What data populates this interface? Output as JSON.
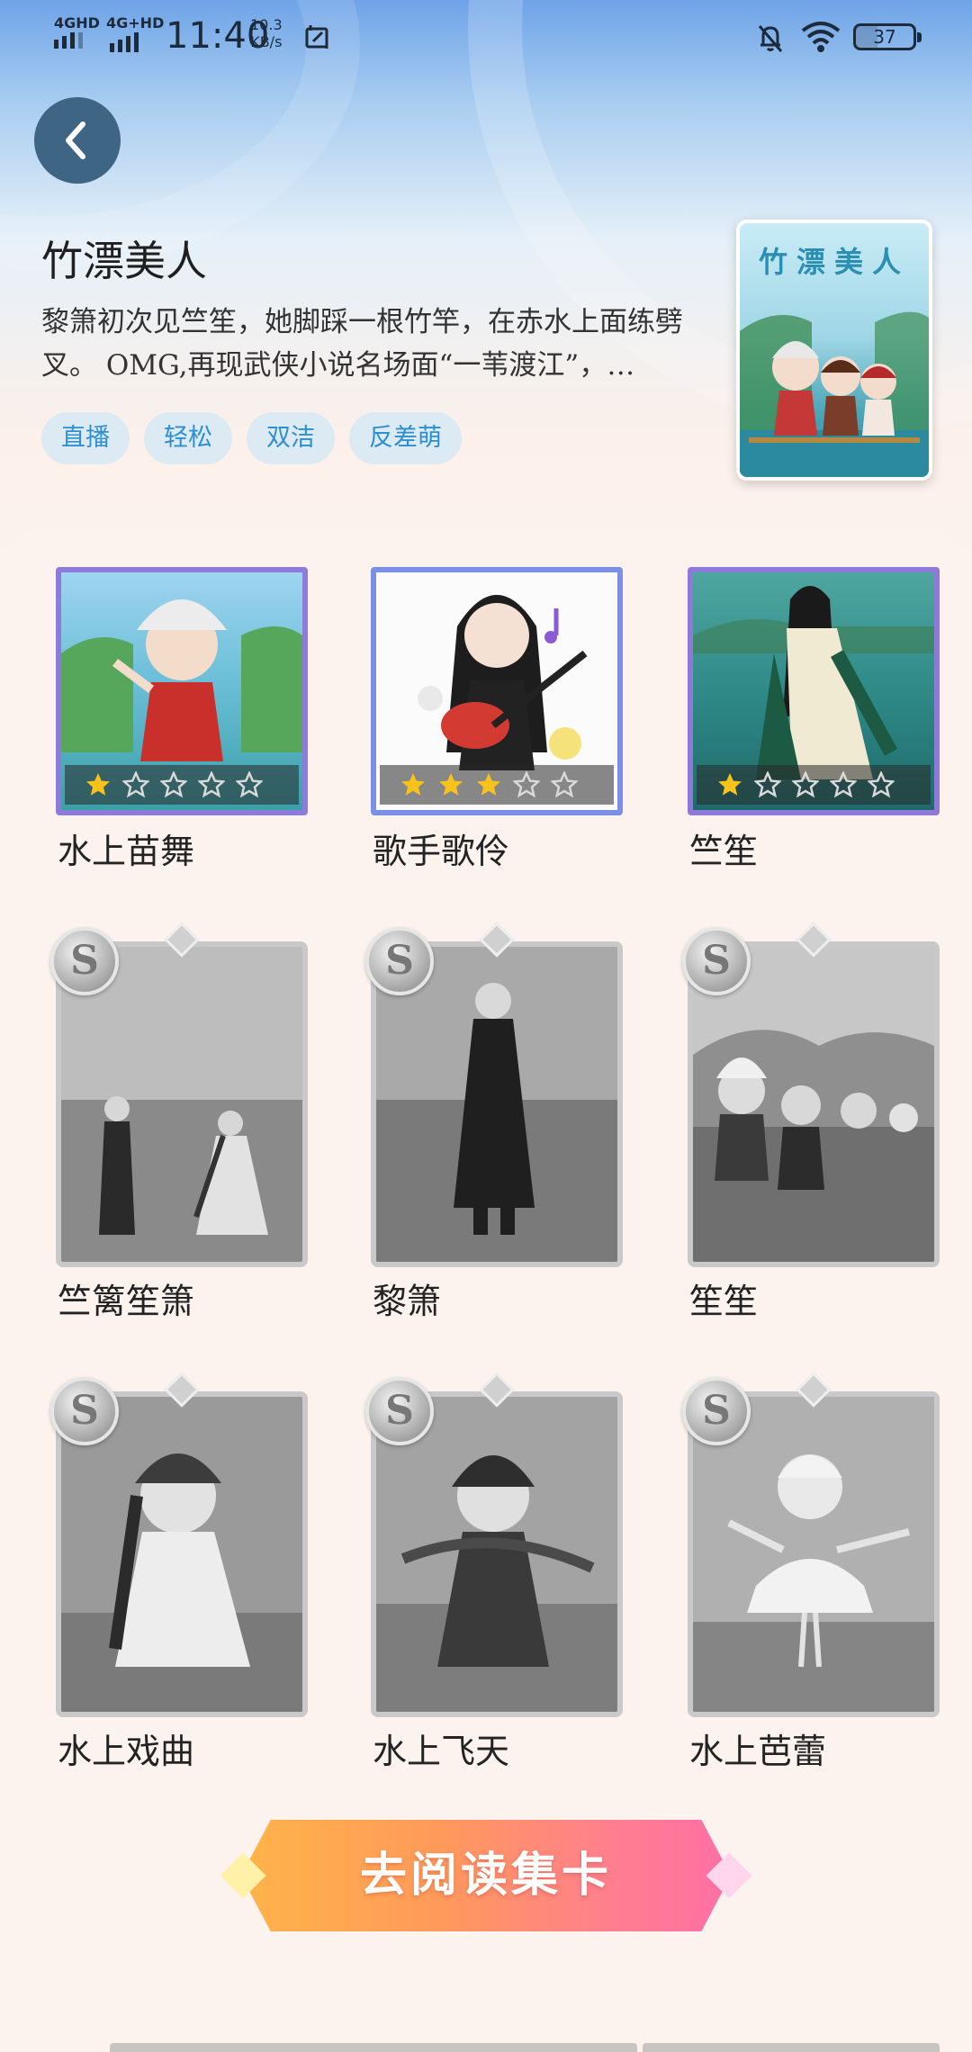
{
  "status_bar": {
    "network1": "4GHD",
    "network2": "4G+HD",
    "time": "11:40",
    "speed_value": "10.3",
    "speed_unit": "KB/s",
    "battery": "37"
  },
  "book": {
    "title": "竹漂美人",
    "description": "黎箫初次见竺笙，她脚踩一根竹竿，在赤水上面练劈叉。 OMG,再现武侠小说名场面“一苇渡江”，…",
    "tags": [
      "直播",
      "轻松",
      "双洁",
      "反差萌"
    ],
    "cover_text": "竹漂美人"
  },
  "cards": [
    {
      "name": "水上苗舞",
      "unlocked": true,
      "stars": 1,
      "max_stars": 5
    },
    {
      "name": "歌手歌伶",
      "unlocked": true,
      "stars": 3,
      "max_stars": 5
    },
    {
      "name": "竺笙",
      "unlocked": true,
      "stars": 1,
      "max_stars": 5
    },
    {
      "name": "竺篱笙箫",
      "unlocked": false,
      "rarity": "S"
    },
    {
      "name": "黎箫",
      "unlocked": false,
      "rarity": "S"
    },
    {
      "name": "笙笙",
      "unlocked": false,
      "rarity": "S"
    },
    {
      "name": "水上戏曲",
      "unlocked": false,
      "rarity": "S"
    },
    {
      "name": "水上飞天",
      "unlocked": false,
      "rarity": "S"
    },
    {
      "name": "水上芭蕾",
      "unlocked": false,
      "rarity": "S"
    }
  ],
  "cta_label": "去阅读集卡",
  "colors": {
    "tag_bg": "#dceaf3",
    "tag_text": "#2d8fd0",
    "back_button": "#3f6585",
    "star_filled": "#f7c21c",
    "cta_start": "#ffb44a",
    "cta_end": "#ff6fa6"
  },
  "icons": {
    "back": "chevron-left-icon",
    "bell": "bell-off-icon",
    "wifi": "wifi-icon",
    "battery": "battery-icon",
    "screenshot": "screenshot-icon",
    "star": "star-icon"
  }
}
